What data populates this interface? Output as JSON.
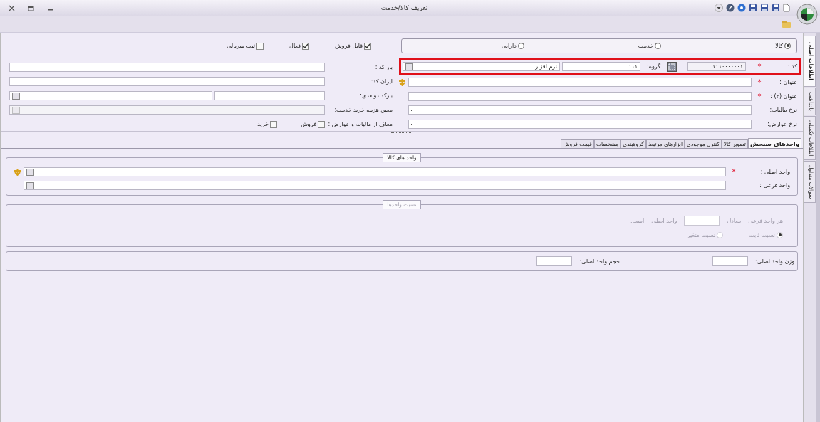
{
  "window": {
    "title": "تعریف کالا/خدمت"
  },
  "item_types": [
    {
      "label": "کالا",
      "selected": true
    },
    {
      "label": "خدمت",
      "selected": false
    },
    {
      "label": "دارایی",
      "selected": false
    }
  ],
  "flags": [
    {
      "label": "قابل فروش",
      "checked": true
    },
    {
      "label": "فعال",
      "checked": true
    },
    {
      "label": "ثبت سریالی",
      "checked": false
    }
  ],
  "main_fields": [
    {
      "kind": "code",
      "label": "کد :",
      "mark": "*",
      "value": "۱۱۱۰۰۰۰۰۰۱",
      "group_label": "گروه:",
      "group_code": "۱۱۱",
      "group_name": "نرم افزار",
      "highlighted": true
    },
    {
      "kind": "hinted",
      "label": "عنوان :",
      "mark": "*"
    },
    {
      "kind": "text",
      "label": "عنوان (۲) :",
      "mark": "*"
    },
    {
      "kind": "select",
      "label": "نرخ مالیات:"
    },
    {
      "kind": "select",
      "label": "نرخ عوارض:"
    }
  ],
  "extra_fields": [
    {
      "kind": "text",
      "label": "بار کد :"
    },
    {
      "kind": "text",
      "label": "ایران کد:"
    },
    {
      "kind": "pair",
      "label": "بارکد دوبعدی:"
    },
    {
      "kind": "select",
      "label": "معین هزینه خرید خدمت:",
      "disabled": true
    },
    {
      "kind": "checks",
      "label": "معاف از مالیات و عوارض :",
      "options": [
        {
          "label": "فروش",
          "checked": false
        },
        {
          "label": "خرید",
          "checked": false
        }
      ]
    }
  ],
  "tabs": [
    {
      "label": "واحدهای سنجش",
      "selected": true
    },
    {
      "label": "تصویر کالا",
      "selected": false
    },
    {
      "label": "کنترل موجودی",
      "selected": false
    },
    {
      "label": "ابزارهای مرتبط",
      "selected": false
    },
    {
      "label": "گروهبندی",
      "selected": false
    },
    {
      "label": "مشخصات",
      "selected": false
    },
    {
      "label": "قیمت فروش",
      "selected": false
    }
  ],
  "units": {
    "title": "واحد های کالا",
    "fields": [
      {
        "kind": "hinted",
        "label": "واحد اصلی :",
        "mark": "*"
      },
      {
        "kind": "plain",
        "label": "واحد فرعی :"
      }
    ]
  },
  "ratio": {
    "title": "نسبت واحدها",
    "disabled": true,
    "sentence": [
      "هر واحد فرعی",
      "معادل",
      "واحد اصلی",
      "است."
    ],
    "options": [
      {
        "label": "نسبت ثابت",
        "selected": true
      },
      {
        "label": "نسبت متغیر",
        "selected": false
      }
    ]
  },
  "measures": [
    {
      "label": "وزن واحد اصلی:"
    },
    {
      "label": "حجم واحد اصلی:"
    }
  ],
  "side_tabs": [
    {
      "label": "اطلاعات اصلی",
      "selected": true
    },
    {
      "label": "یادداشت",
      "selected": false
    },
    {
      "label": "اطلاعات تکمیلی",
      "selected": false
    },
    {
      "label": "سوالات متداول",
      "selected": false
    }
  ]
}
